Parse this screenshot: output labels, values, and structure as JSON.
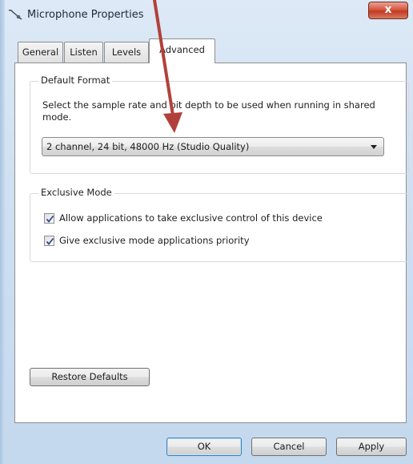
{
  "window": {
    "title": "Microphone Properties",
    "close_label": "x"
  },
  "tabs": [
    {
      "label": "General",
      "active": false
    },
    {
      "label": "Listen",
      "active": false
    },
    {
      "label": "Levels",
      "active": false
    },
    {
      "label": "Advanced",
      "active": true
    }
  ],
  "default_format": {
    "title": "Default Format",
    "description": "Select the sample rate and bit depth to be used when running in shared mode.",
    "selected_format": "2 channel, 24 bit, 48000 Hz (Studio Quality)"
  },
  "exclusive_mode": {
    "title": "Exclusive Mode",
    "options": [
      {
        "label": "Allow applications to take exclusive control of this device",
        "checked": true
      },
      {
        "label": "Give exclusive mode applications priority",
        "checked": true
      }
    ]
  },
  "buttons": {
    "restore_defaults": "Restore Defaults",
    "ok": "OK",
    "cancel": "Cancel",
    "apply": "Apply"
  },
  "colors": {
    "annotation_arrow": "#b2403a",
    "window_frame": "#cfe0f2",
    "default_button_border": "#3c7fb1"
  }
}
